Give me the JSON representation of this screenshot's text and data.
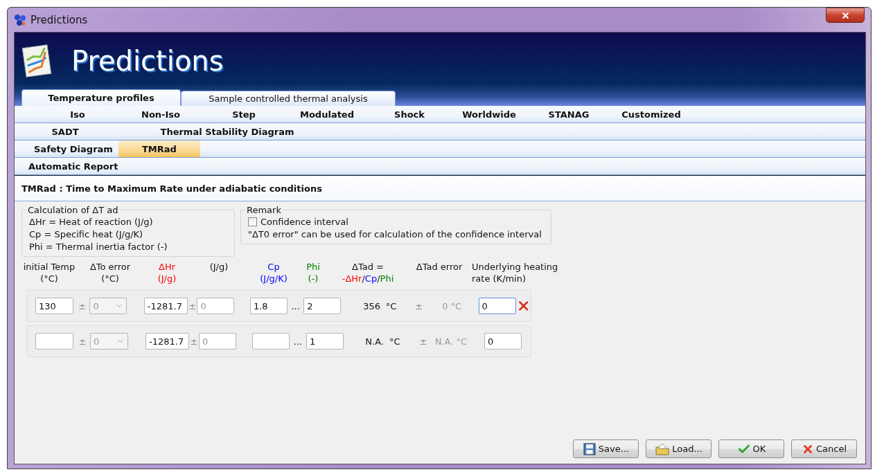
{
  "window": {
    "title": "Predictions"
  },
  "banner": {
    "title": "Predictions"
  },
  "tabs": [
    {
      "label": "Temperature profiles",
      "selected": true
    },
    {
      "label": "Sample controlled thermal analysis",
      "selected": false
    }
  ],
  "menu_rows": [
    [
      {
        "label": "Iso",
        "selected": false
      },
      {
        "label": "Non-Iso",
        "selected": false
      },
      {
        "label": "Step",
        "selected": false
      },
      {
        "label": "Modulated",
        "selected": false
      },
      {
        "label": "Shock",
        "selected": false
      },
      {
        "label": "Worldwide",
        "selected": false
      },
      {
        "label": "STANAG",
        "selected": false
      },
      {
        "label": "Customized",
        "selected": false
      }
    ],
    [
      {
        "label": "SADT",
        "selected": false
      },
      {
        "label": "Thermal Stability Diagram",
        "selected": false
      }
    ],
    [
      {
        "label": "Safety Diagram",
        "selected": false
      },
      {
        "label": "TMRad",
        "selected": true
      }
    ],
    [
      {
        "label": "Automatic Report",
        "selected": false
      }
    ]
  ],
  "section_title": "TMRad : Time to Maximum Rate under adiabatic conditions",
  "calculation_group": {
    "title": "Calculation of ΔT ad",
    "lines": [
      "ΔHr = Heat of reaction (J/g)",
      "Cp = Specific heat (J/g/K)",
      "Phi = Thermal inertia factor (-)"
    ]
  },
  "remark_group": {
    "title": "Remark",
    "checkbox": {
      "label": "Confidence interval",
      "checked": false
    },
    "note": "\"ΔT0 error\" can be used for calculation of the confidence interval"
  },
  "columns": [
    {
      "label": "initial Temp",
      "unit": "(°C)"
    },
    {
      "label": "ΔTo error",
      "unit": "(°C)"
    },
    {
      "label": "ΔHr",
      "unit": "(J/g)",
      "color": "#ff0000"
    },
    {
      "unit": "(J/g)"
    },
    {
      "label": "Cp",
      "unit": "(J/g/K)",
      "color": "#0000ff"
    },
    {
      "label": "Phi",
      "unit": "(-)",
      "color": "#008000"
    },
    {
      "label": "ΔTad =",
      "formula": [
        {
          "text": "-ΔHr",
          "color": "#ff0000"
        },
        {
          "text": "/"
        },
        {
          "text": "Cp",
          "color": "#0000ff"
        },
        {
          "text": "/"
        },
        {
          "text": "Phi",
          "color": "#008000"
        }
      ]
    },
    {
      "label": "ΔTad error"
    },
    {
      "label": "Underlying heating",
      "unit": "rate (K/min)"
    }
  ],
  "rows": [
    {
      "temp": "130",
      "sep_to": "±",
      "to_error": "0",
      "dhr": "-1281.7",
      "sep_dhr": "±",
      "dhr_error": "0",
      "cp": "1.8",
      "sep_cp": "...",
      "phi": "2",
      "tad": "356",
      "tad_unit": "°C",
      "sep_tad": "±",
      "tad_error": "0 °C",
      "heating": "0",
      "focused": true,
      "deletable": true
    },
    {
      "sep_to": "±",
      "to_error": "0",
      "dhr": "-1281.7",
      "sep_dhr": "±",
      "dhr_error": "0",
      "sep_cp": "...",
      "phi": "1",
      "tad": "N.A.",
      "tad_unit": "°C",
      "sep_tad": "±",
      "tad_error": "N.A. °C",
      "heating": "0",
      "focused": false,
      "deletable": false
    }
  ],
  "buttons": [
    {
      "label": "Save...",
      "kind": "save"
    },
    {
      "label": "Load...",
      "kind": "load"
    },
    {
      "label": "OK",
      "kind": "ok"
    },
    {
      "label": "Cancel",
      "kind": "cancel"
    }
  ]
}
